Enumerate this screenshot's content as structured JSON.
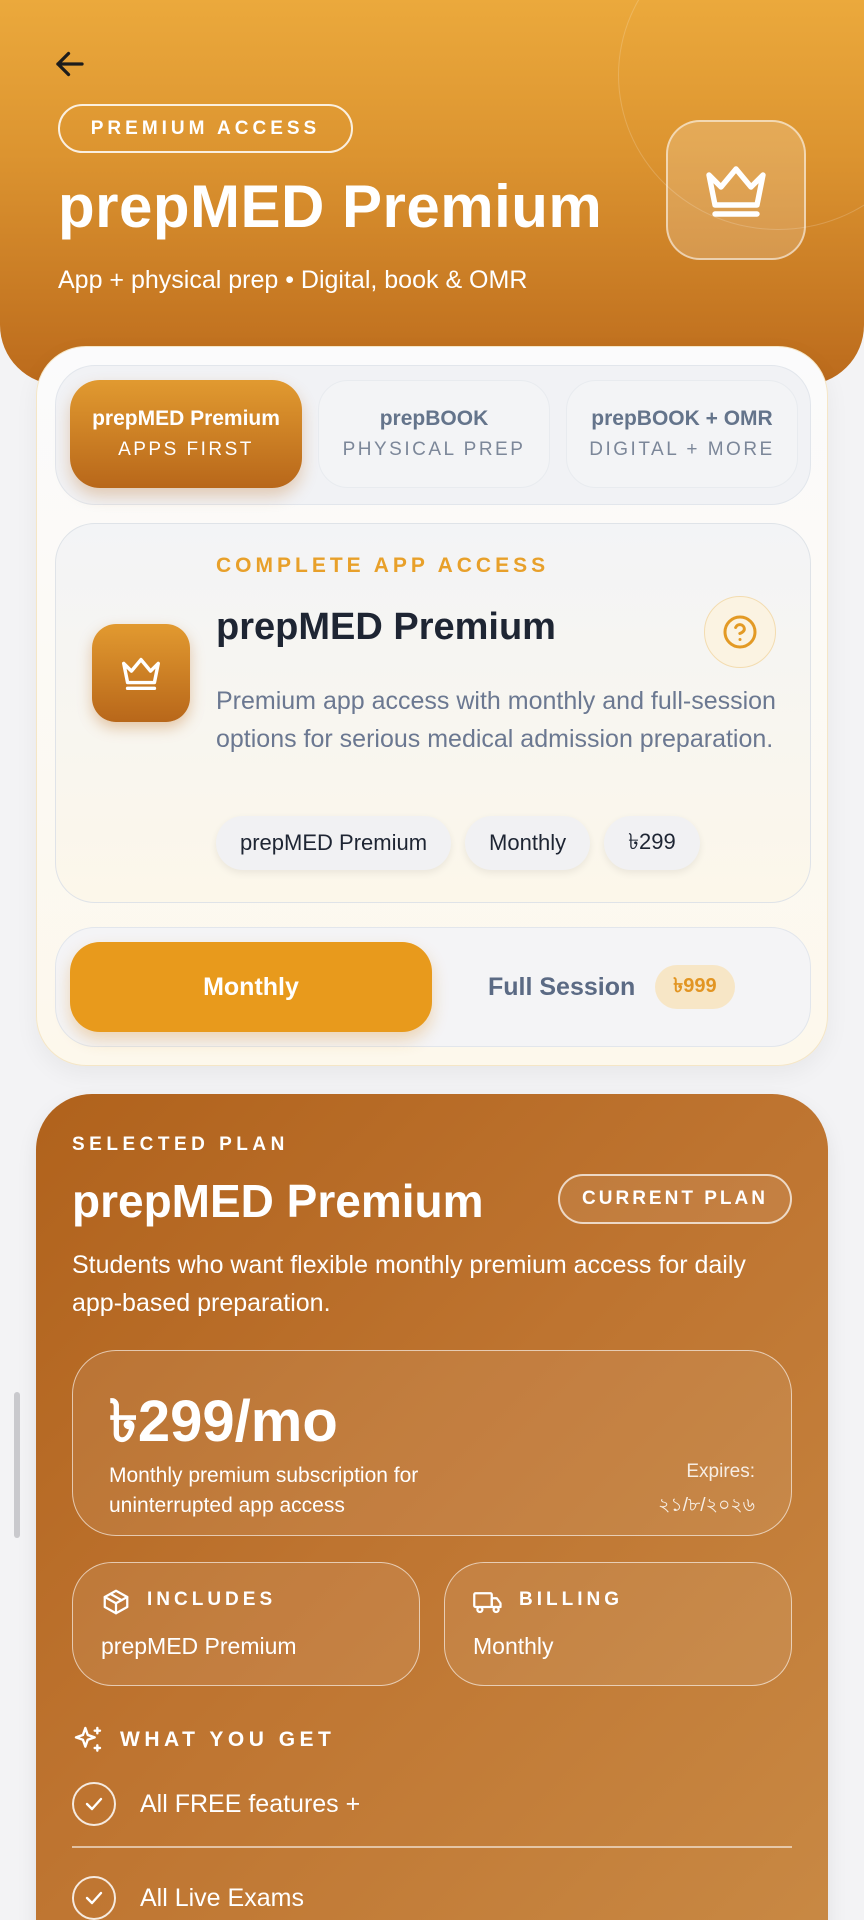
{
  "header": {
    "badge": "PREMIUM ACCESS",
    "title": "prepMED Premium",
    "subtitle": "App + physical prep • Digital, book & OMR"
  },
  "tabs": [
    {
      "title": "prepMED Premium",
      "subtitle": "APPS FIRST",
      "active": true
    },
    {
      "title": "prepBOOK",
      "subtitle": "PHYSICAL PREP",
      "active": false
    },
    {
      "title": "prepBOOK + OMR",
      "subtitle": "DIGITAL + MORE",
      "active": false
    }
  ],
  "info": {
    "kicker": "COMPLETE APP ACCESS",
    "title": "prepMED Premium",
    "description": "Premium app access with monthly and full-session options for serious medical admission preparation.",
    "chips": [
      "prepMED Premium",
      "Monthly",
      "৳299"
    ]
  },
  "period": {
    "monthly_label": "Monthly",
    "full_label": "Full Session",
    "full_price": "৳999"
  },
  "plan": {
    "kicker": "SELECTED PLAN",
    "title": "prepMED Premium",
    "current_badge": "CURRENT PLAN",
    "description": "Students who want flexible monthly premium access for daily app-based preparation.",
    "price": "৳299/mo",
    "price_note": "Monthly premium subscription for uninterrupted app access",
    "expires_label": "Expires:",
    "expires_value": "২১/৮/২০২৬",
    "includes_label": "INCLUDES",
    "includes_value": "prepMED Premium",
    "billing_label": "BILLING",
    "billing_value": "Monthly",
    "wyg_label": "WHAT YOU GET",
    "features": [
      "All FREE features +",
      "All Live Exams"
    ]
  },
  "colors": {
    "accent": "#e89a1c",
    "header_top": "#eba93c",
    "header_bottom": "#bb6a1c",
    "plan_card": "#be7430"
  },
  "icons": [
    "back-arrow-icon",
    "crown-icon",
    "help-icon",
    "box-icon",
    "truck-icon",
    "sparkles-icon",
    "check-icon"
  ]
}
